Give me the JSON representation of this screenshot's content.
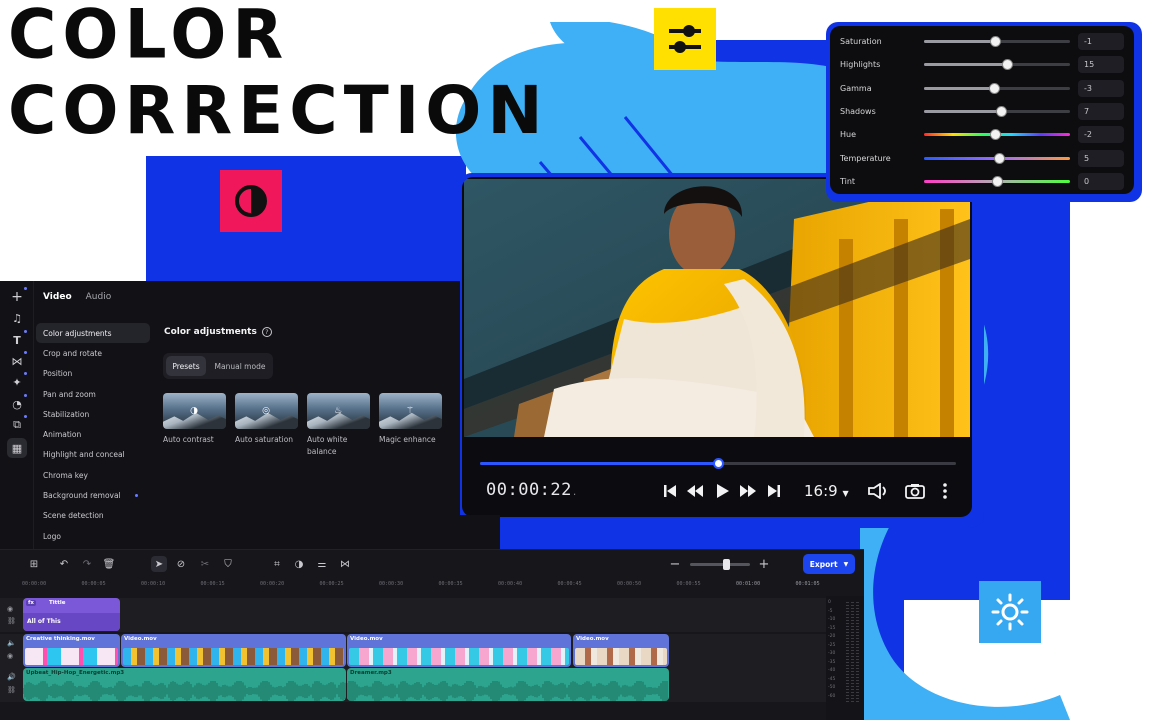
{
  "headline": {
    "line1": "COLOR",
    "line2": "CORRECTION"
  },
  "colors": {
    "brand_blue": "#1133e6",
    "cyan": "#3fb0f5",
    "yellow_tile": "#ffe000",
    "pink_tile": "#f0185a",
    "light_blue_tile": "#36a8f2",
    "accent": "#2c56ff",
    "dark_bg": "#121216"
  },
  "tiles": {
    "adjust": "sliders-icon",
    "contrast": "contrast-icon",
    "brightness": "sun-icon"
  },
  "adjust_panel": {
    "rows": [
      {
        "label": "Saturation",
        "value": "-1",
        "position": 0.49,
        "track": "gray"
      },
      {
        "label": "Highlights",
        "value": "15",
        "position": 0.57,
        "track": "gray"
      },
      {
        "label": "Gamma",
        "value": "-3",
        "position": 0.48,
        "track": "gray"
      },
      {
        "label": "Shadows",
        "value": "7",
        "position": 0.53,
        "track": "gray"
      },
      {
        "label": "Hue",
        "value": "-2",
        "position": 0.49,
        "track": "hue"
      },
      {
        "label": "Temperature",
        "value": "5",
        "position": 0.52,
        "track": "temperature"
      },
      {
        "label": "Tint",
        "value": "0",
        "position": 0.5,
        "track": "tint"
      }
    ]
  },
  "editor": {
    "tabs": {
      "video": "Video",
      "audio": "Audio"
    },
    "rail_icons": [
      "plus-icon",
      "music-icon",
      "text-icon",
      "transition-icon",
      "magic-icon",
      "sticker-icon",
      "media-icon",
      "layout-icon"
    ],
    "menu": [
      {
        "label": "Color adjustments",
        "active": true,
        "dot": false
      },
      {
        "label": "Crop and rotate",
        "active": false,
        "dot": false
      },
      {
        "label": "Position",
        "active": false,
        "dot": false
      },
      {
        "label": "Pan and zoom",
        "active": false,
        "dot": false
      },
      {
        "label": "Stabilization",
        "active": false,
        "dot": false
      },
      {
        "label": "Animation",
        "active": false,
        "dot": false
      },
      {
        "label": "Highlight and conceal",
        "active": false,
        "dot": false
      },
      {
        "label": "Chroma key",
        "active": false,
        "dot": false
      },
      {
        "label": "Background removal",
        "active": false,
        "dot": true
      },
      {
        "label": "Scene detection",
        "active": false,
        "dot": false
      },
      {
        "label": "Logo",
        "active": false,
        "dot": false
      }
    ],
    "section_title": "Color adjustments",
    "modes": {
      "presets": "Presets",
      "manual": "Manual mode"
    },
    "presets": [
      {
        "label": "Auto contrast",
        "icon": "contrast-icon"
      },
      {
        "label": "Auto saturation",
        "icon": "saturation-icon"
      },
      {
        "label": "Auto white balance",
        "icon": "bulb-icon"
      },
      {
        "label": "Magic enhance",
        "icon": "magic-wand-icon"
      }
    ]
  },
  "player": {
    "timecode": "00:00:22",
    "timecode_frac": ".",
    "progress": 0.5,
    "ratio": "16:9"
  },
  "timeline": {
    "export_label": "Export",
    "ruler": [
      "00:00:00",
      "00:00:05",
      "00:00:10",
      "00:00:15",
      "00:00:20",
      "00:00:25",
      "00:00:30",
      "00:00:35",
      "00:00:40",
      "00:00:45",
      "00:00:50",
      "00:00:55",
      "00:01:00",
      "00:01:05"
    ],
    "title_clip": {
      "fx": "fx",
      "name": "Tittle",
      "text": "All of This"
    },
    "video_clips": [
      "Creative thinking.mov",
      "Video.mov",
      "Video.mov",
      "Video.mov"
    ],
    "audio_clips": [
      "Upbeat_Hip-Hop_Energetic.mp3",
      "Dreamer.mp3"
    ],
    "meter_labels": [
      "0",
      "-5",
      "-10",
      "-15",
      "-20",
      "-25",
      "-30",
      "-35",
      "-40",
      "-45",
      "-50",
      "-60"
    ]
  }
}
